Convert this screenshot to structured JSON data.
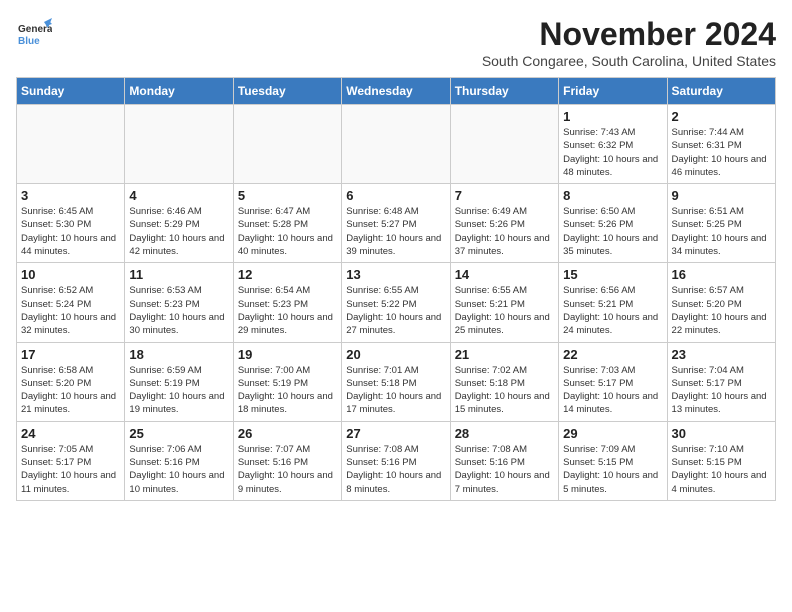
{
  "header": {
    "logo_general": "General",
    "logo_blue": "Blue",
    "title": "November 2024",
    "subtitle": "South Congaree, South Carolina, United States"
  },
  "calendar": {
    "days_of_week": [
      "Sunday",
      "Monday",
      "Tuesday",
      "Wednesday",
      "Thursday",
      "Friday",
      "Saturday"
    ],
    "weeks": [
      [
        {
          "day": "",
          "info": ""
        },
        {
          "day": "",
          "info": ""
        },
        {
          "day": "",
          "info": ""
        },
        {
          "day": "",
          "info": ""
        },
        {
          "day": "",
          "info": ""
        },
        {
          "day": "1",
          "info": "Sunrise: 7:43 AM\nSunset: 6:32 PM\nDaylight: 10 hours and 48 minutes."
        },
        {
          "day": "2",
          "info": "Sunrise: 7:44 AM\nSunset: 6:31 PM\nDaylight: 10 hours and 46 minutes."
        }
      ],
      [
        {
          "day": "3",
          "info": "Sunrise: 6:45 AM\nSunset: 5:30 PM\nDaylight: 10 hours and 44 minutes."
        },
        {
          "day": "4",
          "info": "Sunrise: 6:46 AM\nSunset: 5:29 PM\nDaylight: 10 hours and 42 minutes."
        },
        {
          "day": "5",
          "info": "Sunrise: 6:47 AM\nSunset: 5:28 PM\nDaylight: 10 hours and 40 minutes."
        },
        {
          "day": "6",
          "info": "Sunrise: 6:48 AM\nSunset: 5:27 PM\nDaylight: 10 hours and 39 minutes."
        },
        {
          "day": "7",
          "info": "Sunrise: 6:49 AM\nSunset: 5:26 PM\nDaylight: 10 hours and 37 minutes."
        },
        {
          "day": "8",
          "info": "Sunrise: 6:50 AM\nSunset: 5:26 PM\nDaylight: 10 hours and 35 minutes."
        },
        {
          "day": "9",
          "info": "Sunrise: 6:51 AM\nSunset: 5:25 PM\nDaylight: 10 hours and 34 minutes."
        }
      ],
      [
        {
          "day": "10",
          "info": "Sunrise: 6:52 AM\nSunset: 5:24 PM\nDaylight: 10 hours and 32 minutes."
        },
        {
          "day": "11",
          "info": "Sunrise: 6:53 AM\nSunset: 5:23 PM\nDaylight: 10 hours and 30 minutes."
        },
        {
          "day": "12",
          "info": "Sunrise: 6:54 AM\nSunset: 5:23 PM\nDaylight: 10 hours and 29 minutes."
        },
        {
          "day": "13",
          "info": "Sunrise: 6:55 AM\nSunset: 5:22 PM\nDaylight: 10 hours and 27 minutes."
        },
        {
          "day": "14",
          "info": "Sunrise: 6:55 AM\nSunset: 5:21 PM\nDaylight: 10 hours and 25 minutes."
        },
        {
          "day": "15",
          "info": "Sunrise: 6:56 AM\nSunset: 5:21 PM\nDaylight: 10 hours and 24 minutes."
        },
        {
          "day": "16",
          "info": "Sunrise: 6:57 AM\nSunset: 5:20 PM\nDaylight: 10 hours and 22 minutes."
        }
      ],
      [
        {
          "day": "17",
          "info": "Sunrise: 6:58 AM\nSunset: 5:20 PM\nDaylight: 10 hours and 21 minutes."
        },
        {
          "day": "18",
          "info": "Sunrise: 6:59 AM\nSunset: 5:19 PM\nDaylight: 10 hours and 19 minutes."
        },
        {
          "day": "19",
          "info": "Sunrise: 7:00 AM\nSunset: 5:19 PM\nDaylight: 10 hours and 18 minutes."
        },
        {
          "day": "20",
          "info": "Sunrise: 7:01 AM\nSunset: 5:18 PM\nDaylight: 10 hours and 17 minutes."
        },
        {
          "day": "21",
          "info": "Sunrise: 7:02 AM\nSunset: 5:18 PM\nDaylight: 10 hours and 15 minutes."
        },
        {
          "day": "22",
          "info": "Sunrise: 7:03 AM\nSunset: 5:17 PM\nDaylight: 10 hours and 14 minutes."
        },
        {
          "day": "23",
          "info": "Sunrise: 7:04 AM\nSunset: 5:17 PM\nDaylight: 10 hours and 13 minutes."
        }
      ],
      [
        {
          "day": "24",
          "info": "Sunrise: 7:05 AM\nSunset: 5:17 PM\nDaylight: 10 hours and 11 minutes."
        },
        {
          "day": "25",
          "info": "Sunrise: 7:06 AM\nSunset: 5:16 PM\nDaylight: 10 hours and 10 minutes."
        },
        {
          "day": "26",
          "info": "Sunrise: 7:07 AM\nSunset: 5:16 PM\nDaylight: 10 hours and 9 minutes."
        },
        {
          "day": "27",
          "info": "Sunrise: 7:08 AM\nSunset: 5:16 PM\nDaylight: 10 hours and 8 minutes."
        },
        {
          "day": "28",
          "info": "Sunrise: 7:08 AM\nSunset: 5:16 PM\nDaylight: 10 hours and 7 minutes."
        },
        {
          "day": "29",
          "info": "Sunrise: 7:09 AM\nSunset: 5:15 PM\nDaylight: 10 hours and 5 minutes."
        },
        {
          "day": "30",
          "info": "Sunrise: 7:10 AM\nSunset: 5:15 PM\nDaylight: 10 hours and 4 minutes."
        }
      ]
    ]
  }
}
